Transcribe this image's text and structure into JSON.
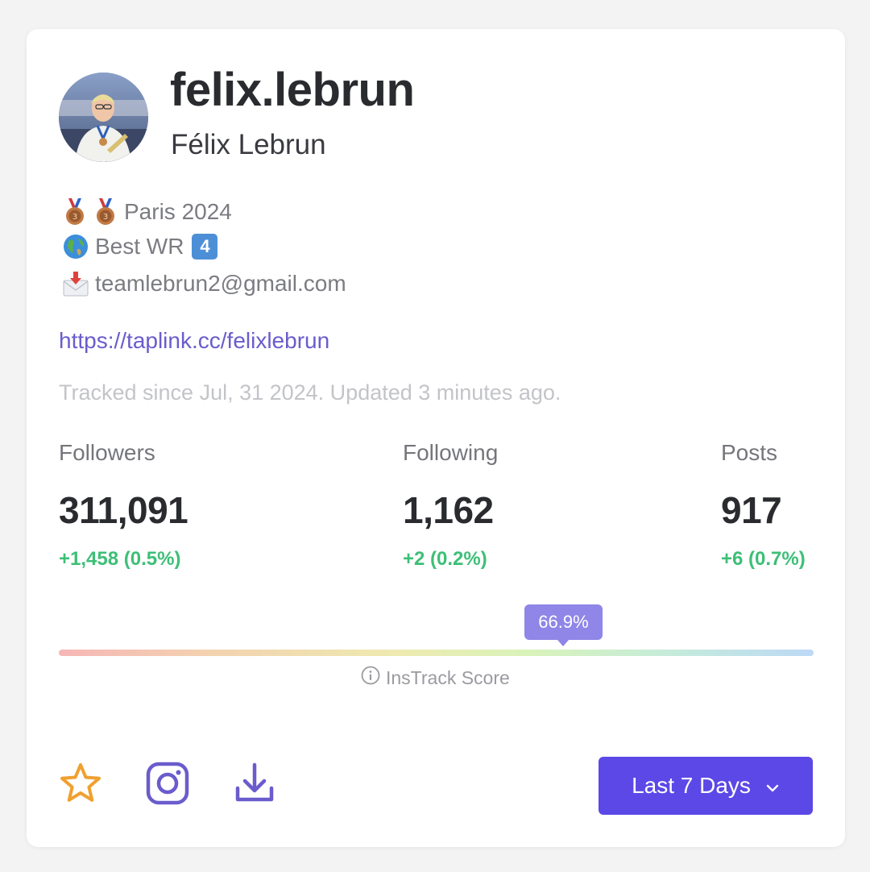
{
  "profile": {
    "username": "felix.lebrun",
    "full_name": "Félix Lebrun",
    "avatar_icon": "profile-photo"
  },
  "bio": {
    "line1": {
      "icons": [
        "bronze-medal-icon",
        "bronze-medal-icon"
      ],
      "text": "Paris 2024"
    },
    "line2": {
      "icon": "globe-icon",
      "text": "Best WR",
      "badge": "4"
    },
    "line3": {
      "icon": "envelope-icon",
      "text": "teamlebrun2@gmail.com"
    }
  },
  "link": "https://taplink.cc/felixlebrun",
  "tracked_text": "Tracked since Jul, 31 2024. Updated 3 minutes ago.",
  "stats": [
    {
      "label": "Followers",
      "value": "311,091",
      "delta": "+1,458 (0.5%)"
    },
    {
      "label": "Following",
      "value": "1,162",
      "delta": "+2 (0.2%)"
    },
    {
      "label": "Posts",
      "value": "917",
      "delta": "+6 (0.7%)"
    }
  ],
  "score": {
    "value_label": "66.9%",
    "value": 0.669,
    "label": "InsTrack Score"
  },
  "actions": {
    "favorite_icon": "star-icon",
    "instagram_icon": "instagram-icon",
    "download_icon": "download-icon"
  },
  "range_select": {
    "label": "Last 7 Days"
  },
  "colors": {
    "accent": "#5b48e6",
    "positive": "#3dbf77",
    "link": "#6a5ccc",
    "star": "#f0a030"
  }
}
